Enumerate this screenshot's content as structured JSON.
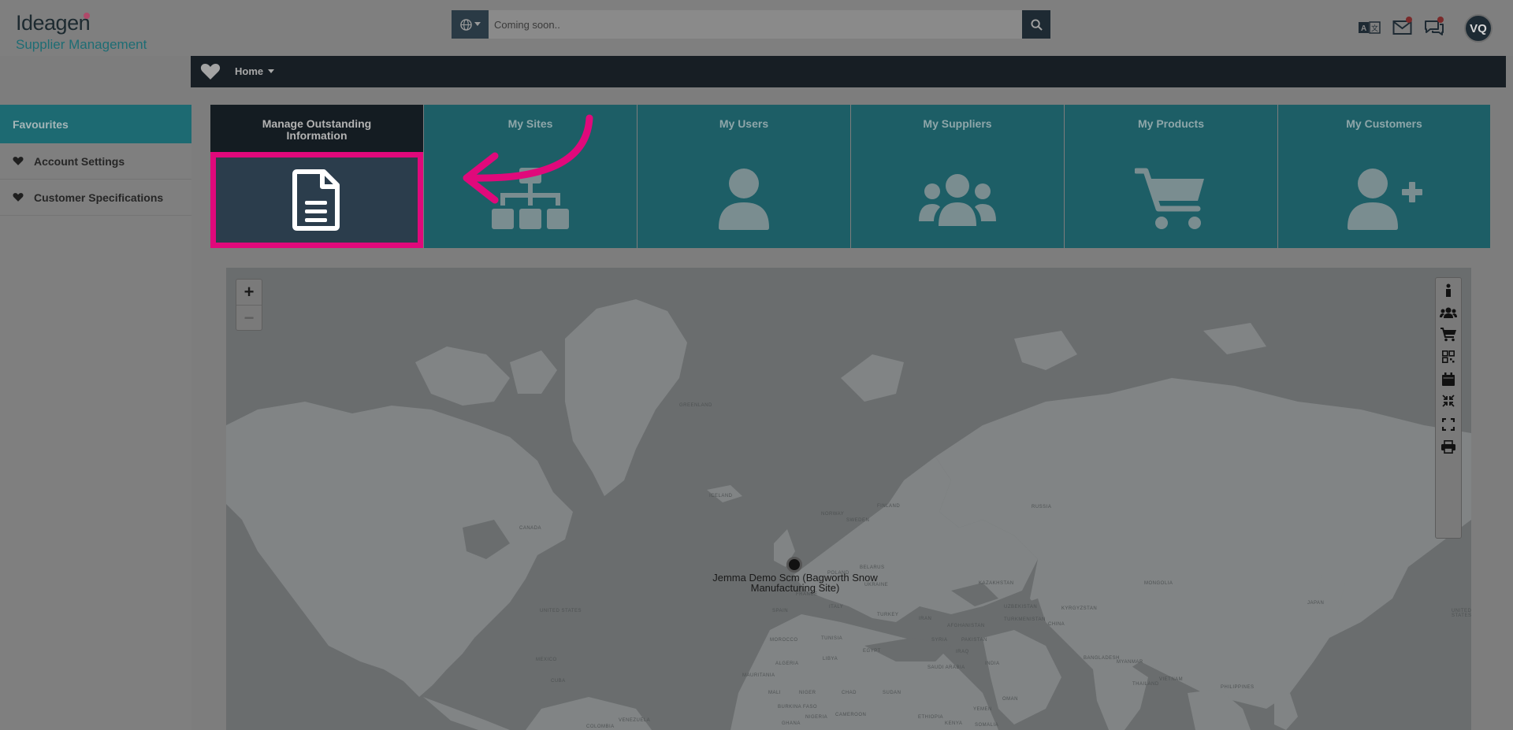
{
  "header": {
    "logo_word": "Ideagen",
    "logo_subtitle": "Supplier Management",
    "search_placeholder": "Coming soon..",
    "avatar_initials": "VQ"
  },
  "nav": {
    "home_label": "Home"
  },
  "sidebar": {
    "heading": "Favourites",
    "items": [
      {
        "label": "Account Settings"
      },
      {
        "label": "Customer Specifications"
      }
    ]
  },
  "tiles": [
    {
      "label": "Manage Outstanding Information",
      "icon": "document-icon"
    },
    {
      "label": "My Sites",
      "icon": "sitemap-icon"
    },
    {
      "label": "My Users",
      "icon": "user-icon"
    },
    {
      "label": "My Suppliers",
      "icon": "users-group-icon"
    },
    {
      "label": "My Products",
      "icon": "cart-icon"
    },
    {
      "label": "My Customers",
      "icon": "user-plus-icon"
    }
  ],
  "map": {
    "zoom_in": "+",
    "zoom_out": "−",
    "marker_label": "Jemma Demo Scm (Bagworth Snow Manufacturing Site)",
    "countries": [
      "GREENLAND",
      "CANADA",
      "UNITED STATES",
      "MEXICO",
      "RUSSIA",
      "KAZAKHSTAN",
      "CHINA",
      "INDIA",
      "IRAN",
      "TURKEY",
      "EGYPT",
      "ALGERIA",
      "LIBYA",
      "MALI",
      "NIGER",
      "CHAD",
      "SUDAN",
      "NIGERIA",
      "ETHIOPIA",
      "SAUDI ARABIA",
      "PAKISTAN",
      "AFGHANISTAN",
      "UKRAINE",
      "BELARUS",
      "POLAND",
      "SPAIN",
      "FRANCE",
      "ITALY",
      "MONGOLIA",
      "JAPAN",
      "UNITED STATES",
      "BANGLADESH",
      "MYANMAR",
      "THAILAND",
      "VIETNAM",
      "PHILIPPINES",
      "CUBA",
      "VENEZUELA",
      "COLOMBIA",
      "MOROCCO",
      "TUNISIA",
      "IRAQ",
      "SYRIA",
      "OMAN",
      "YEMEN",
      "KENYA",
      "SOMALIA",
      "UZBEKISTAN",
      "TURKMENISTAN",
      "KYRGYZSTAN",
      "NORWAY",
      "SWEDEN",
      "FINLAND",
      "ICELAND",
      "CAMEROON",
      "GHANA",
      "BURKINA FASO",
      "MAURITANIA"
    ]
  },
  "colors": {
    "accent_highlight": "#e0097b",
    "tile_teal": "#1d5e66",
    "nav_dark": "#171e24"
  }
}
